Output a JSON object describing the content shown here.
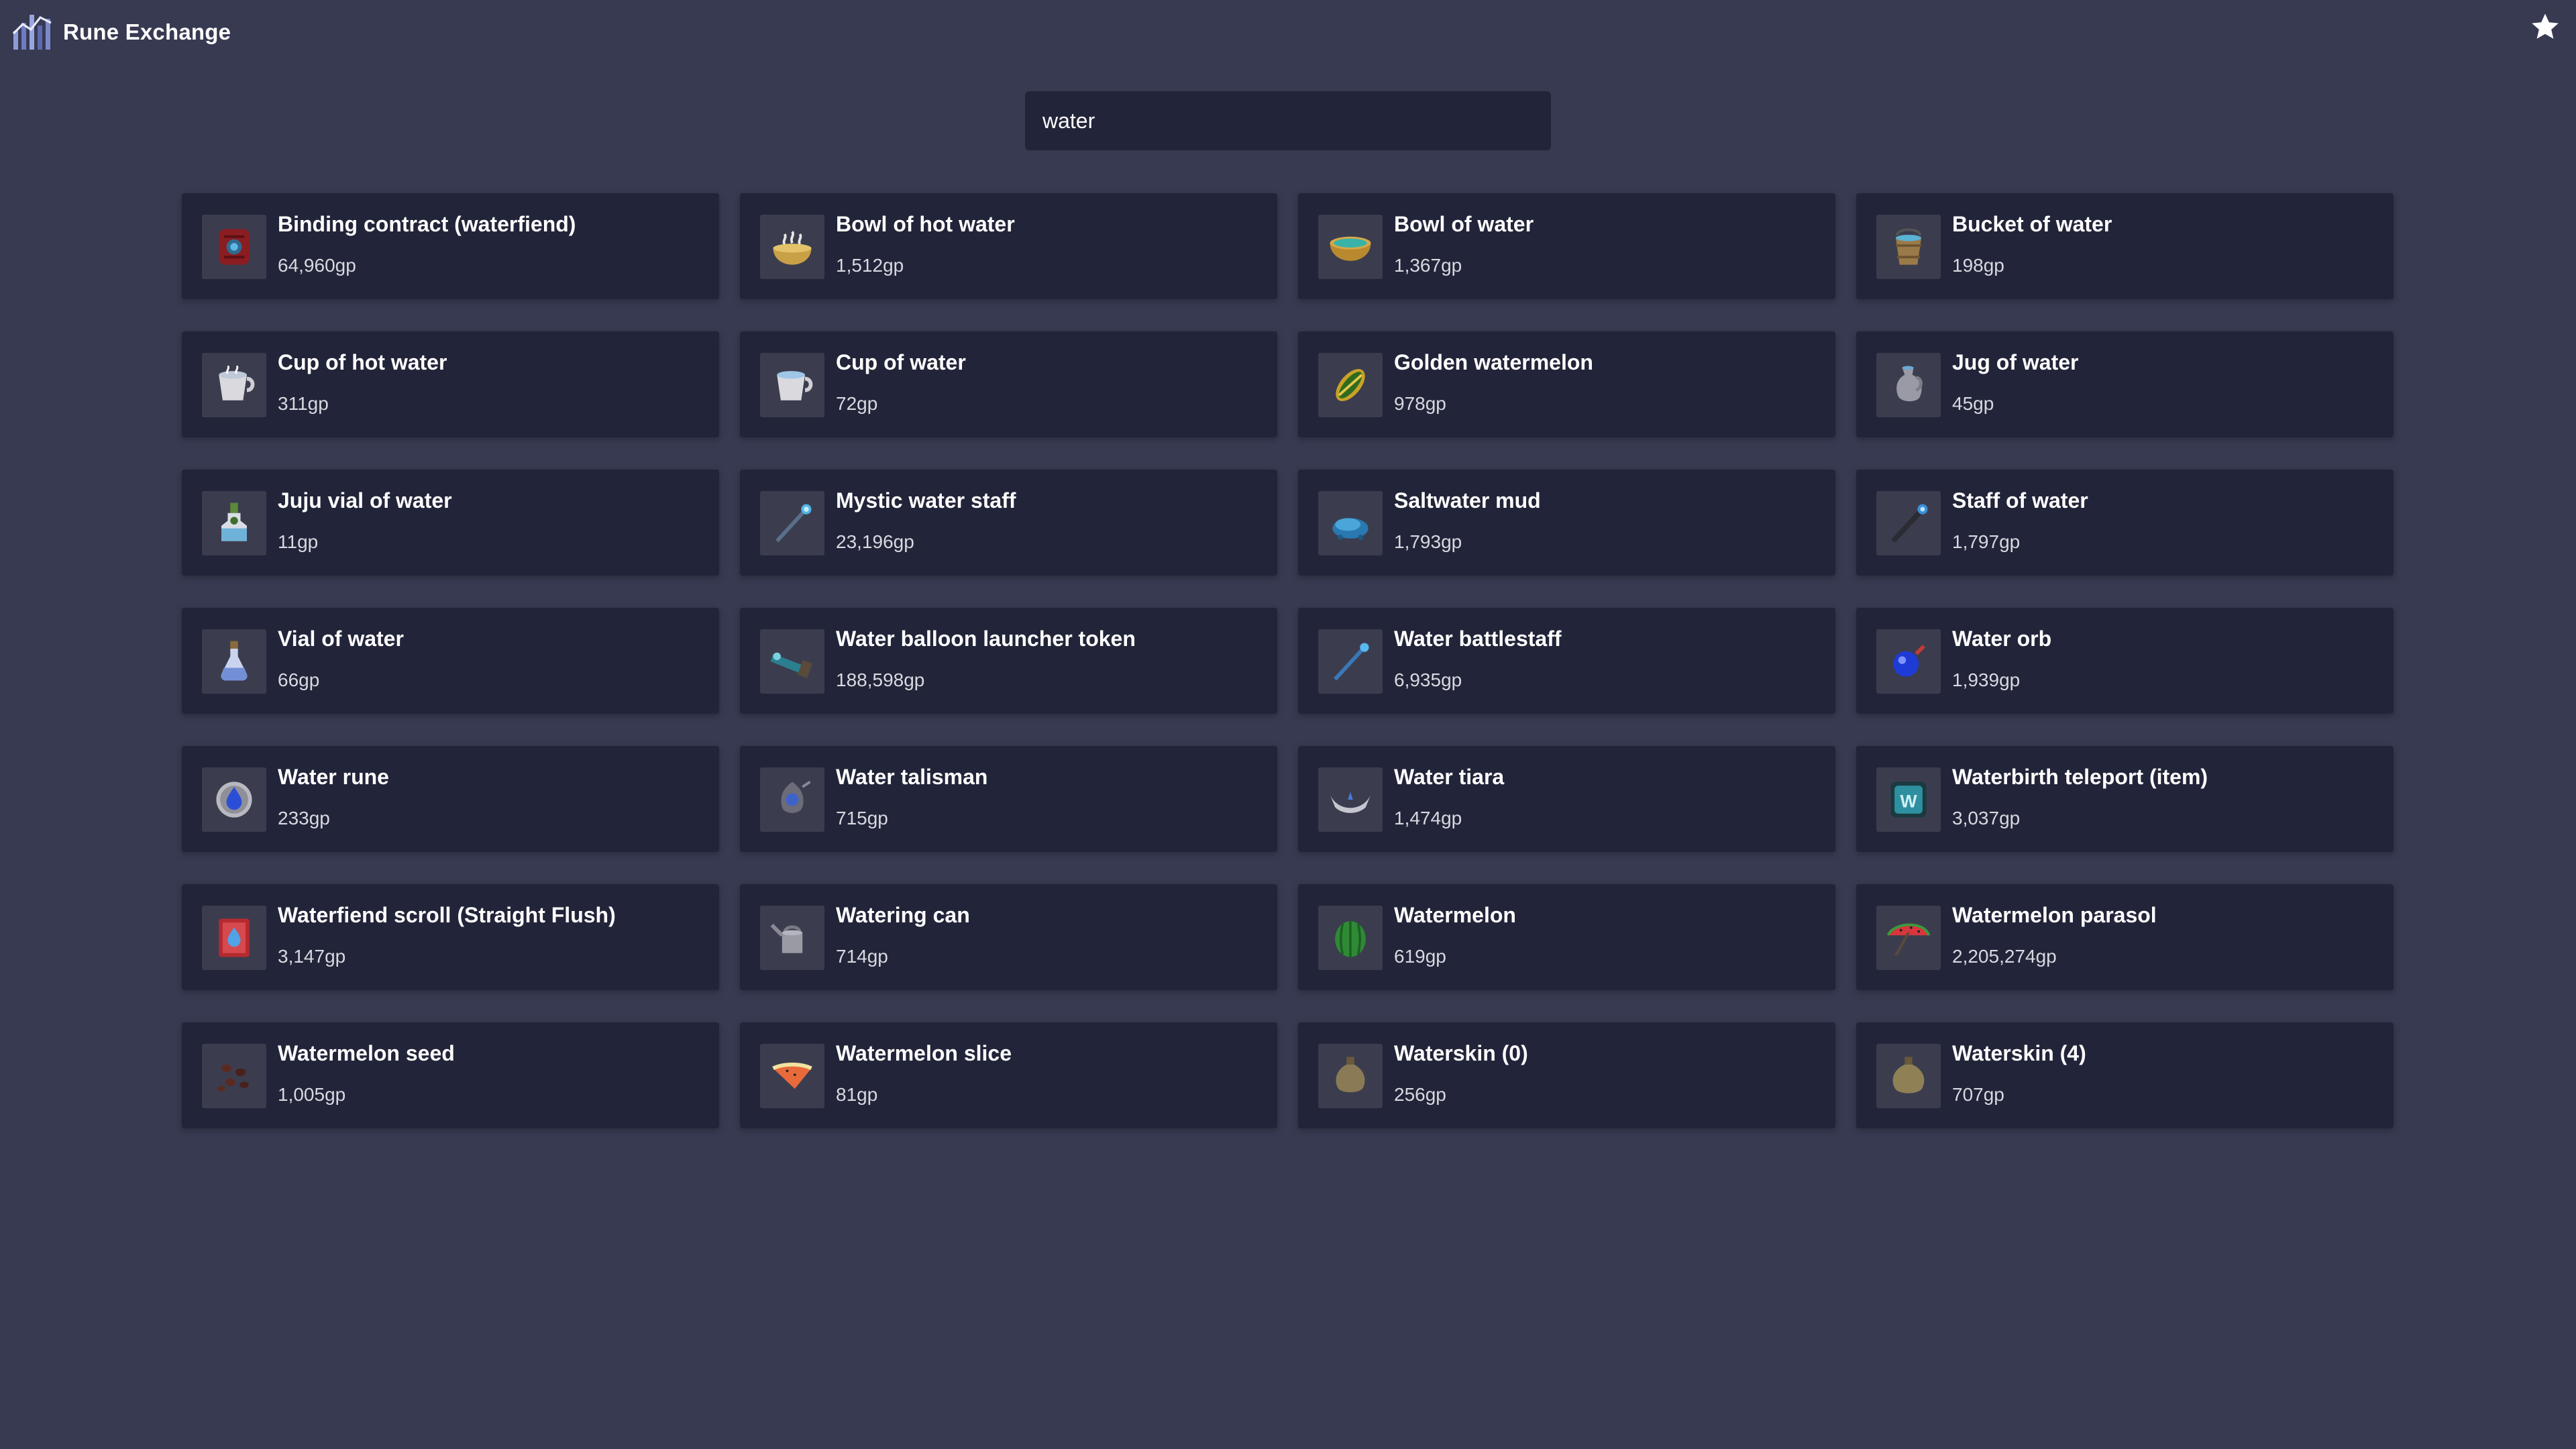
{
  "app": {
    "title": "Rune Exchange",
    "logo_icon": "exchange-logo-icon",
    "favorite_icon": "star-icon"
  },
  "search": {
    "value": "water",
    "placeholder": ""
  },
  "items": [
    {
      "name": "Binding contract (waterfiend)",
      "price": "64,960gp",
      "icon": "binding-contract-icon"
    },
    {
      "name": "Bowl of hot water",
      "price": "1,512gp",
      "icon": "bowl-hot-water-icon"
    },
    {
      "name": "Bowl of water",
      "price": "1,367gp",
      "icon": "bowl-water-icon"
    },
    {
      "name": "Bucket of water",
      "price": "198gp",
      "icon": "bucket-water-icon"
    },
    {
      "name": "Cup of hot water",
      "price": "311gp",
      "icon": "cup-hot-water-icon"
    },
    {
      "name": "Cup of water",
      "price": "72gp",
      "icon": "cup-water-icon"
    },
    {
      "name": "Golden watermelon",
      "price": "978gp",
      "icon": "golden-watermelon-icon"
    },
    {
      "name": "Jug of water",
      "price": "45gp",
      "icon": "jug-water-icon"
    },
    {
      "name": "Juju vial of water",
      "price": "11gp",
      "icon": "juju-vial-icon"
    },
    {
      "name": "Mystic water staff",
      "price": "23,196gp",
      "icon": "mystic-staff-icon"
    },
    {
      "name": "Saltwater mud",
      "price": "1,793gp",
      "icon": "saltwater-mud-icon"
    },
    {
      "name": "Staff of water",
      "price": "1,797gp",
      "icon": "staff-water-icon"
    },
    {
      "name": "Vial of water",
      "price": "66gp",
      "icon": "vial-water-icon"
    },
    {
      "name": "Water balloon launcher token",
      "price": "188,598gp",
      "icon": "balloon-launcher-token-icon"
    },
    {
      "name": "Water battlestaff",
      "price": "6,935gp",
      "icon": "battlestaff-icon"
    },
    {
      "name": "Water orb",
      "price": "1,939gp",
      "icon": "water-orb-icon"
    },
    {
      "name": "Water rune",
      "price": "233gp",
      "icon": "water-rune-icon"
    },
    {
      "name": "Water talisman",
      "price": "715gp",
      "icon": "water-talisman-icon"
    },
    {
      "name": "Water tiara",
      "price": "1,474gp",
      "icon": "water-tiara-icon"
    },
    {
      "name": "Waterbirth teleport (item)",
      "price": "3,037gp",
      "icon": "waterbirth-teleport-icon"
    },
    {
      "name": "Waterfiend scroll (Straight Flush)",
      "price": "3,147gp",
      "icon": "waterfiend-scroll-icon"
    },
    {
      "name": "Watering can",
      "price": "714gp",
      "icon": "watering-can-icon"
    },
    {
      "name": "Watermelon",
      "price": "619gp",
      "icon": "watermelon-icon"
    },
    {
      "name": "Watermelon parasol",
      "price": "2,205,274gp",
      "icon": "watermelon-parasol-icon"
    },
    {
      "name": "Watermelon seed",
      "price": "1,005gp",
      "icon": "watermelon-seed-icon"
    },
    {
      "name": "Watermelon slice",
      "price": "81gp",
      "icon": "watermelon-slice-icon"
    },
    {
      "name": "Waterskin (0)",
      "price": "256gp",
      "icon": "waterskin-0-icon"
    },
    {
      "name": "Waterskin (4)",
      "price": "707gp",
      "icon": "waterskin-4-icon"
    }
  ]
}
